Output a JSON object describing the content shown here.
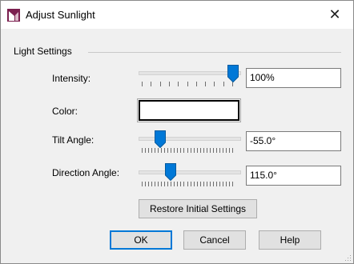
{
  "window": {
    "title": "Adjust Sunlight",
    "close_glyph": "✕",
    "icon": "app-logo-icon",
    "accent_color": "#7b1f4f"
  },
  "group": {
    "label": "Light Settings"
  },
  "intensity": {
    "label": "Intensity:",
    "value": "100%",
    "level": 1.0
  },
  "color": {
    "label": "Color:",
    "swatch_color": "#ffffff"
  },
  "tilt": {
    "label": "Tilt Angle:",
    "value": "-55.0°",
    "level": 0.18
  },
  "direction": {
    "label": "Direction Angle:",
    "value": "115.0°",
    "level": 0.33
  },
  "buttons": {
    "restore": "Restore Initial Settings",
    "ok": "OK",
    "cancel": "Cancel",
    "help": "Help"
  }
}
